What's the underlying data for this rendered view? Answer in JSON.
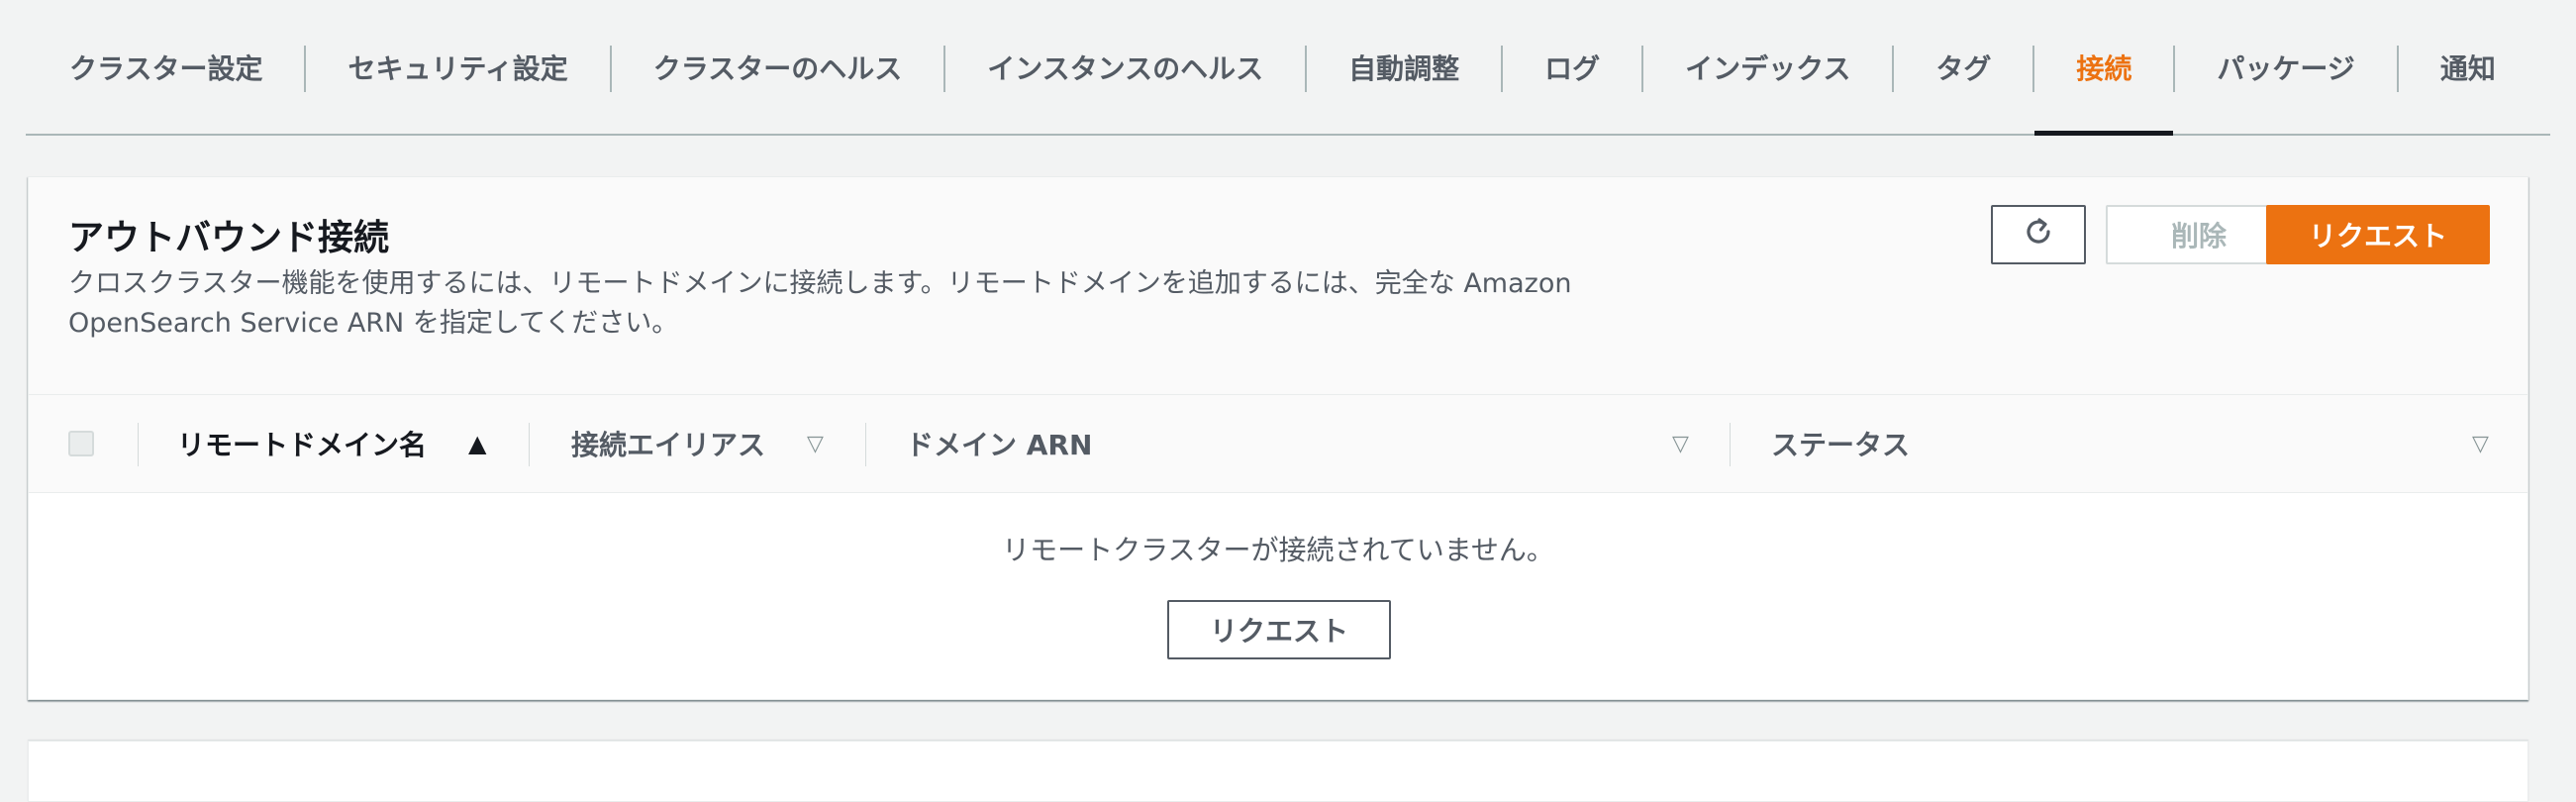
{
  "tabs": [
    {
      "label": "クラスター設定",
      "active": false
    },
    {
      "label": "セキュリティ設定",
      "active": false
    },
    {
      "label": "クラスターのヘルス",
      "active": false
    },
    {
      "label": "インスタンスのヘルス",
      "active": false
    },
    {
      "label": "自動調整",
      "active": false
    },
    {
      "label": "ログ",
      "active": false
    },
    {
      "label": "インデックス",
      "active": false
    },
    {
      "label": "タグ",
      "active": false
    },
    {
      "label": "接続",
      "active": true
    },
    {
      "label": "パッケージ",
      "active": false
    },
    {
      "label": "通知",
      "active": false
    }
  ],
  "panel": {
    "title": "アウトバウンド接続",
    "description": "クロスクラスター機能を使用するには、リモートドメインに接続します。リモートドメインを追加するには、完全な Amazon OpenSearch Service ARN を指定してください。",
    "refresh_icon": "refresh-icon",
    "delete_label": "削除",
    "request_label": "リクエスト"
  },
  "table": {
    "columns": [
      {
        "label": "リモートドメイン名",
        "sort": "ascending"
      },
      {
        "label": "接続エイリアス",
        "sort": "none"
      },
      {
        "label": "ドメイン ARN",
        "sort": "none"
      },
      {
        "label": "ステータス",
        "sort": "none"
      }
    ],
    "empty_text": "リモートクラスターが接続されていません。",
    "empty_request_label": "リクエスト"
  },
  "colors": {
    "accent": "#ec7211",
    "text": "#16191f",
    "muted": "#545b64"
  }
}
